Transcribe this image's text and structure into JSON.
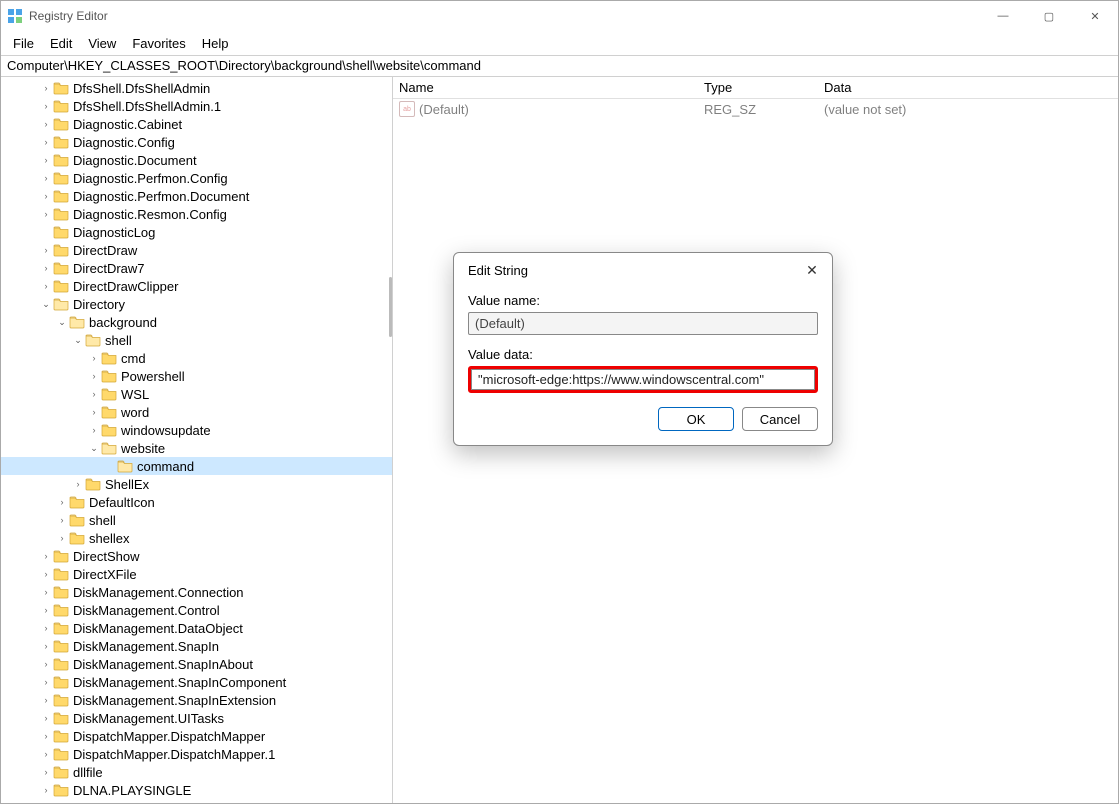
{
  "colors": {
    "highlight_red": "#e00000",
    "selection": "#cde8ff"
  },
  "title": "Registry Editor",
  "win_controls": {
    "min": "—",
    "max": "▢",
    "close": "✕"
  },
  "menus": [
    "File",
    "Edit",
    "View",
    "Favorites",
    "Help"
  ],
  "address": "Computer\\HKEY_CLASSES_ROOT\\Directory\\background\\shell\\website\\command",
  "tree": [
    {
      "d": 2,
      "e": "c",
      "label": "DfsShell.DfsShellAdmin"
    },
    {
      "d": 2,
      "e": "c",
      "label": "DfsShell.DfsShellAdmin.1"
    },
    {
      "d": 2,
      "e": "c",
      "label": "Diagnostic.Cabinet"
    },
    {
      "d": 2,
      "e": "c",
      "label": "Diagnostic.Config"
    },
    {
      "d": 2,
      "e": "c",
      "label": "Diagnostic.Document"
    },
    {
      "d": 2,
      "e": "c",
      "label": "Diagnostic.Perfmon.Config"
    },
    {
      "d": 2,
      "e": "c",
      "label": "Diagnostic.Perfmon.Document"
    },
    {
      "d": 2,
      "e": "c",
      "label": "Diagnostic.Resmon.Config"
    },
    {
      "d": 2,
      "e": "n",
      "label": "DiagnosticLog"
    },
    {
      "d": 2,
      "e": "c",
      "label": "DirectDraw"
    },
    {
      "d": 2,
      "e": "c",
      "label": "DirectDraw7"
    },
    {
      "d": 2,
      "e": "c",
      "label": "DirectDrawClipper"
    },
    {
      "d": 2,
      "e": "o",
      "label": "Directory"
    },
    {
      "d": 3,
      "e": "o",
      "label": "background"
    },
    {
      "d": 4,
      "e": "o",
      "label": "shell"
    },
    {
      "d": 5,
      "e": "c",
      "label": "cmd"
    },
    {
      "d": 5,
      "e": "c",
      "label": "Powershell"
    },
    {
      "d": 5,
      "e": "c",
      "label": "WSL"
    },
    {
      "d": 5,
      "e": "c",
      "label": "word"
    },
    {
      "d": 5,
      "e": "c",
      "label": "windowsupdate"
    },
    {
      "d": 5,
      "e": "o",
      "label": "website"
    },
    {
      "d": 6,
      "e": "n",
      "label": "command",
      "selected": true
    },
    {
      "d": 4,
      "e": "c",
      "label": "ShellEx"
    },
    {
      "d": 3,
      "e": "c",
      "label": "DefaultIcon"
    },
    {
      "d": 3,
      "e": "c",
      "label": "shell"
    },
    {
      "d": 3,
      "e": "c",
      "label": "shellex"
    },
    {
      "d": 2,
      "e": "c",
      "label": "DirectShow"
    },
    {
      "d": 2,
      "e": "c",
      "label": "DirectXFile"
    },
    {
      "d": 2,
      "e": "c",
      "label": "DiskManagement.Connection"
    },
    {
      "d": 2,
      "e": "c",
      "label": "DiskManagement.Control"
    },
    {
      "d": 2,
      "e": "c",
      "label": "DiskManagement.DataObject"
    },
    {
      "d": 2,
      "e": "c",
      "label": "DiskManagement.SnapIn"
    },
    {
      "d": 2,
      "e": "c",
      "label": "DiskManagement.SnapInAbout"
    },
    {
      "d": 2,
      "e": "c",
      "label": "DiskManagement.SnapInComponent"
    },
    {
      "d": 2,
      "e": "c",
      "label": "DiskManagement.SnapInExtension"
    },
    {
      "d": 2,
      "e": "c",
      "label": "DiskManagement.UITasks"
    },
    {
      "d": 2,
      "e": "c",
      "label": "DispatchMapper.DispatchMapper"
    },
    {
      "d": 2,
      "e": "c",
      "label": "DispatchMapper.DispatchMapper.1"
    },
    {
      "d": 2,
      "e": "c",
      "label": "dllfile"
    },
    {
      "d": 2,
      "e": "c",
      "label": "DLNA.PLAYSINGLE"
    }
  ],
  "list": {
    "headers": {
      "name": "Name",
      "type": "Type",
      "data": "Data"
    },
    "rows": [
      {
        "name": "(Default)",
        "type": "REG_SZ",
        "data": "(value not set)"
      }
    ]
  },
  "dialog": {
    "title": "Edit String",
    "name_label": "Value name:",
    "name_value": "(Default)",
    "data_label": "Value data:",
    "data_value": "\"microsoft-edge:https://www.windowscentral.com\"",
    "ok": "OK",
    "cancel": "Cancel",
    "close": "✕"
  }
}
